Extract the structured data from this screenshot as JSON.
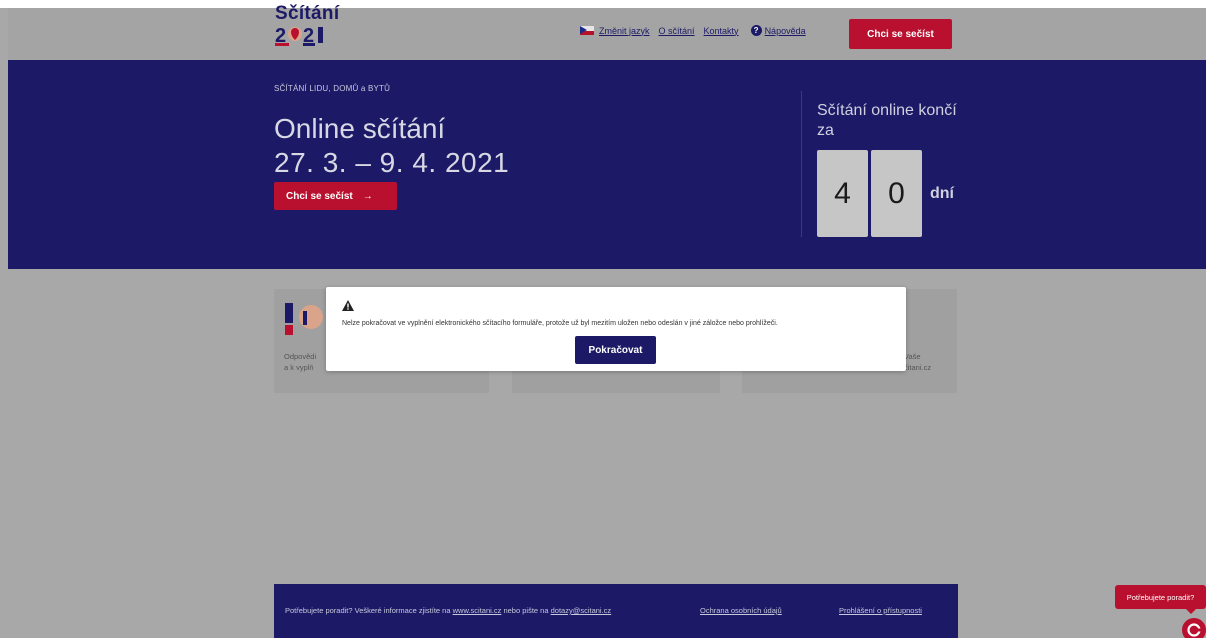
{
  "header": {
    "logo_word": "Sčítání",
    "logo_year": "2021",
    "nav": {
      "language": "Změnit jazyk",
      "about": "O sčítání",
      "contacts": "Kontakty",
      "help": "Nápověda"
    },
    "cta": "Chci se sečíst"
  },
  "hero": {
    "eyebrow": "SČÍTÁNÍ LIDU, DOMŮ a BYTŮ",
    "title": "Online sčítání",
    "dates": "27. 3. – 9. 4. 2021",
    "cta": "Chci se sečíst",
    "cta_arrow": "→",
    "countdown_label": "Sčítání online končí za",
    "digits": [
      "4",
      "0"
    ],
    "unit": "dní"
  },
  "cards": [
    {
      "text_line1": "Odpovědi",
      "text_line2": "a k vyplň"
    },
    {
      "text_line1": "",
      "text_line2": ""
    },
    {
      "text_line1": "Vaše",
      "text_line2": "čitani.cz"
    }
  ],
  "modal": {
    "icon": "warning-icon",
    "message": "Nelze pokračovat ve vyplnění elektronického sčítacího formuláře, protože už byl mezitím uložen nebo odeslán v jiné záložce nebo prohlížeči.",
    "button": "Pokračovat"
  },
  "footer": {
    "text_before": "Potřebujete poradit? Veškeré informace zjistíte na",
    "link_web": "www.scitani.cz",
    "text_middle": "nebo pište na",
    "link_email": "dotazy@scitani.cz",
    "privacy": "Ochrana osobních údajů",
    "accessibility": "Prohlášení o přístupnosti"
  },
  "help_widget": {
    "bubble": "Potřebujete poradit?",
    "launcher_icon": "chat-logo-icon"
  },
  "colors": {
    "brand_navy": "#1c1a66",
    "brand_red": "#b8102e",
    "overlay_gray": "#a8a8a8"
  }
}
